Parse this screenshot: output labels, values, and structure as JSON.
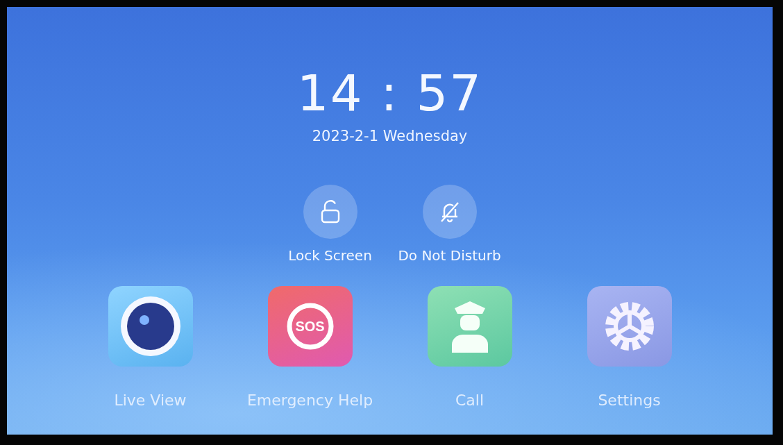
{
  "clock": {
    "time": "14 : 57",
    "date": "2023-2-1 Wednesday"
  },
  "quick_actions": [
    {
      "label": "Lock Screen",
      "kind": "lock"
    },
    {
      "label": "Do Not Disturb",
      "kind": "bell-off"
    }
  ],
  "apps": [
    {
      "label": "Live View",
      "kind": "camera"
    },
    {
      "label": "Emergency Help",
      "kind": "sos",
      "badge": "SOS"
    },
    {
      "label": "Call",
      "kind": "guard"
    },
    {
      "label": "Settings",
      "kind": "gear"
    }
  ]
}
